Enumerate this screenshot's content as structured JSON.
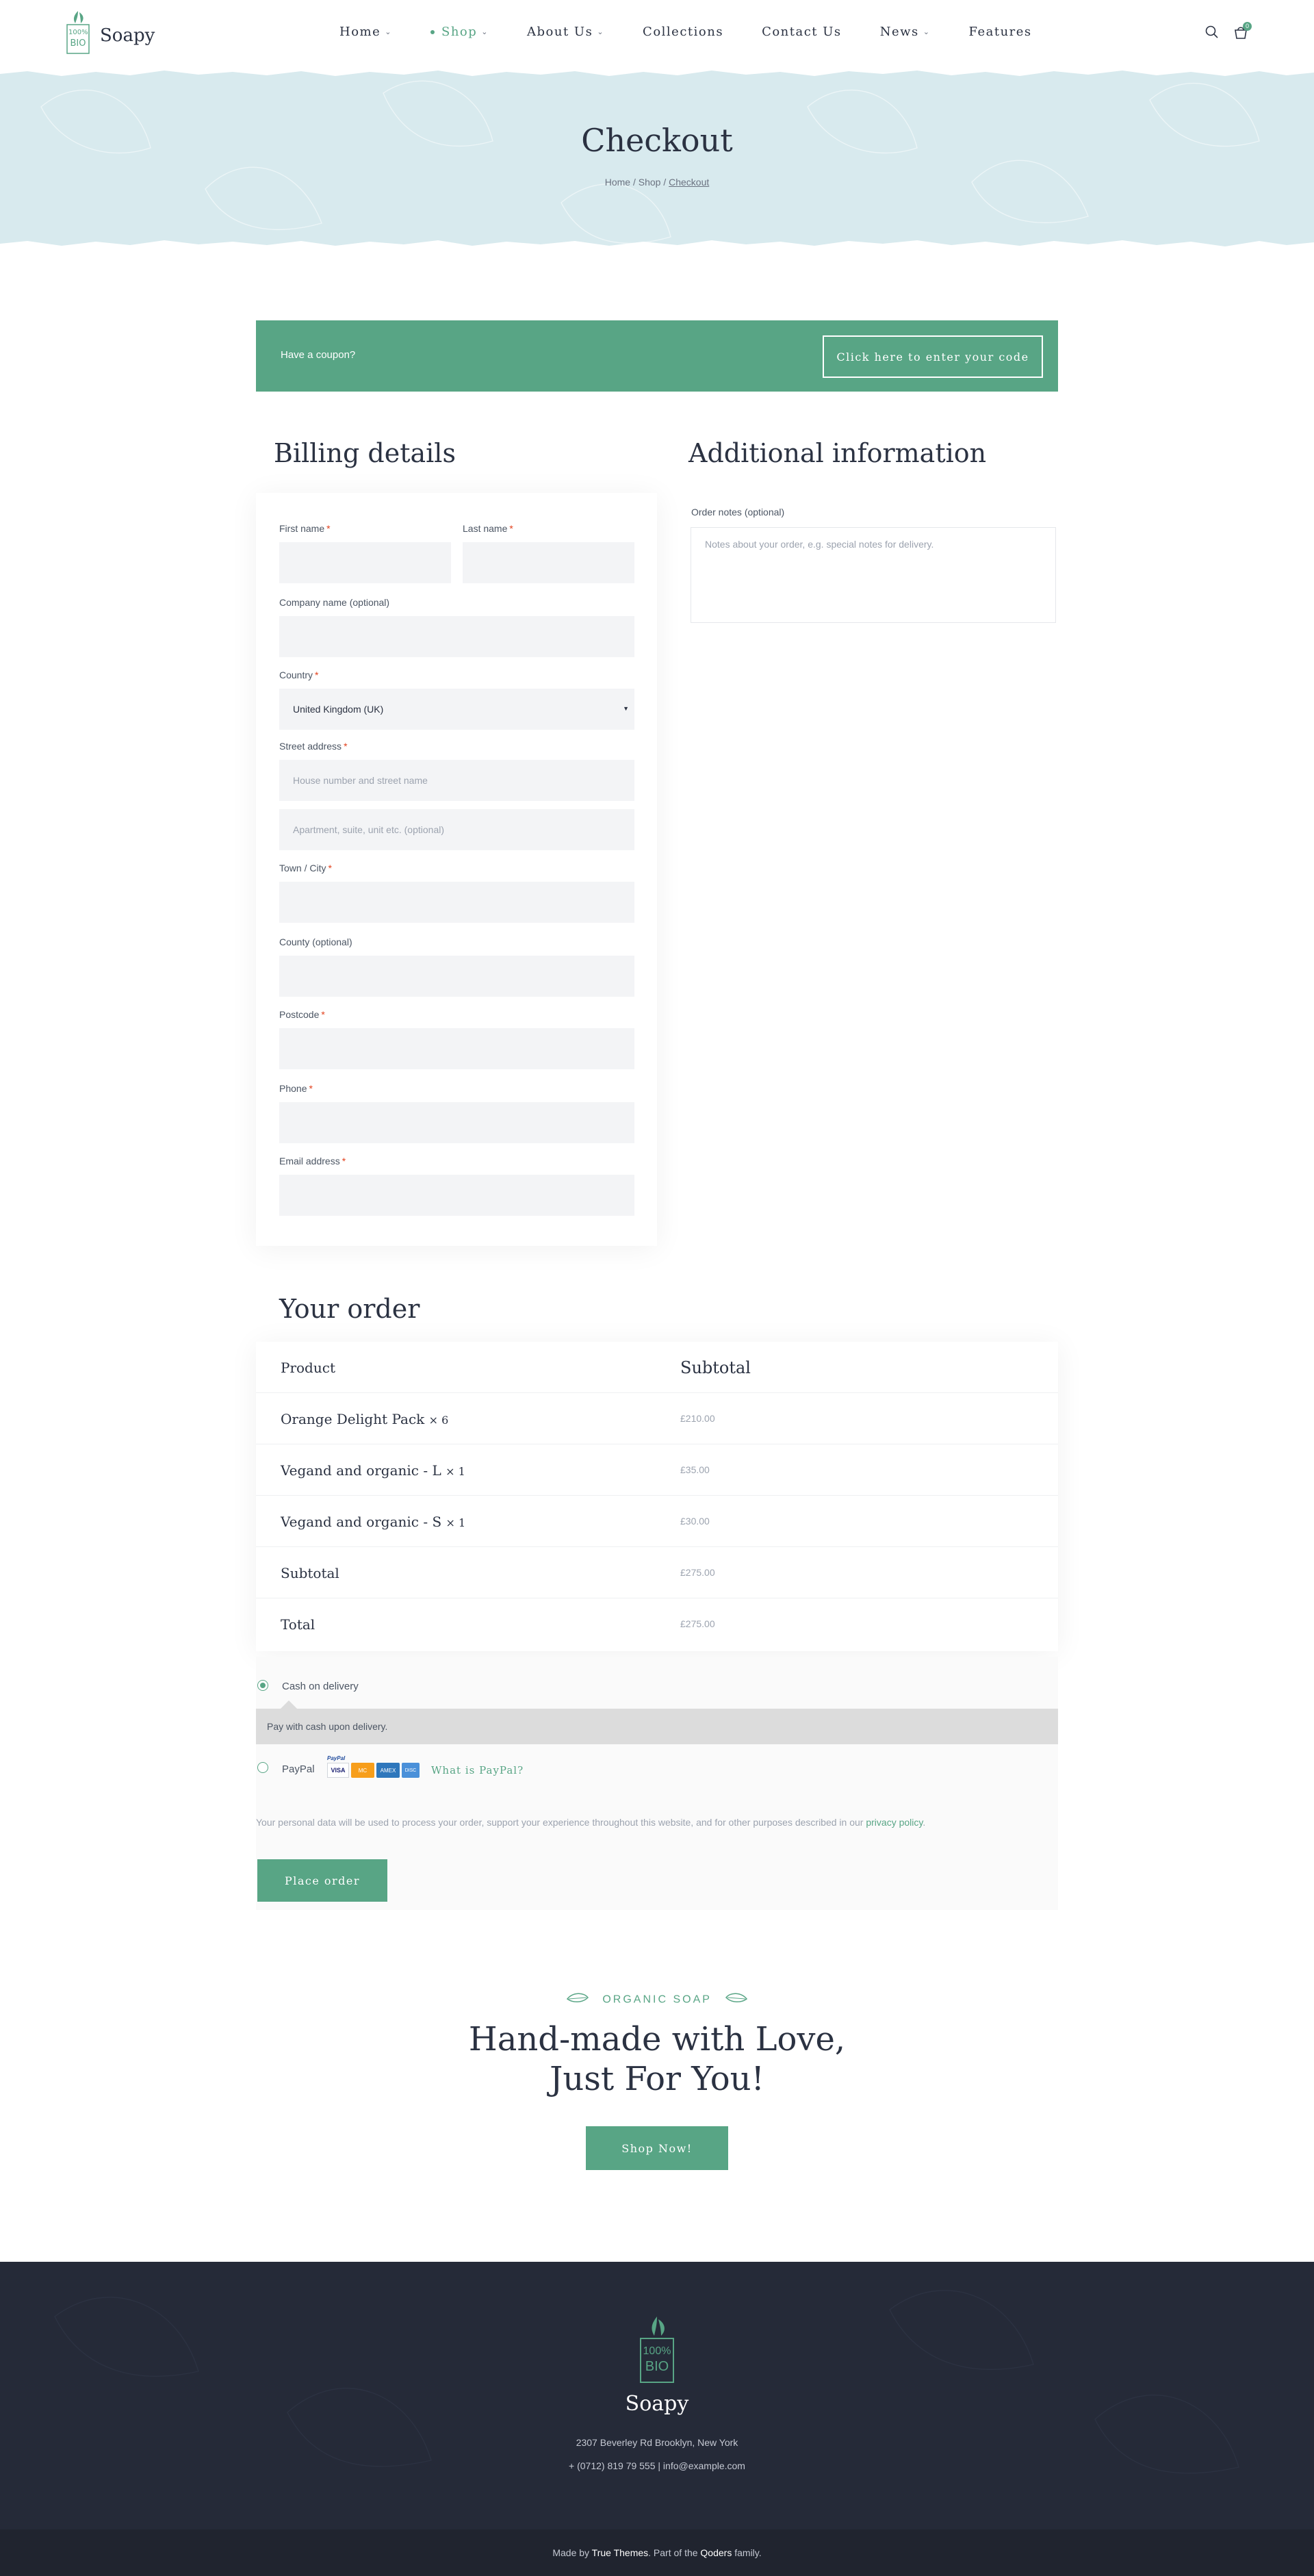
{
  "brand": {
    "name": "Soapy",
    "badge_top": "100%",
    "badge_bottom": "BIO"
  },
  "nav": {
    "items": [
      {
        "label": "Home",
        "has_dropdown": true,
        "active": false
      },
      {
        "label": "Shop",
        "has_dropdown": true,
        "active": true
      },
      {
        "label": "About Us",
        "has_dropdown": true,
        "active": false
      },
      {
        "label": "Collections",
        "has_dropdown": false,
        "active": false
      },
      {
        "label": "Contact Us",
        "has_dropdown": false,
        "active": false
      },
      {
        "label": "News",
        "has_dropdown": true,
        "active": false
      },
      {
        "label": "Features",
        "has_dropdown": false,
        "active": false
      }
    ],
    "cart_count": "0"
  },
  "hero": {
    "title": "Checkout",
    "breadcrumb": {
      "home": "Home",
      "shop": "Shop",
      "current": "Checkout",
      "sep": "/"
    }
  },
  "coupon": {
    "text": "Have a coupon?",
    "button": "Click here to enter your code"
  },
  "billing": {
    "title": "Billing details",
    "fields": {
      "first_name": "First name",
      "last_name": "Last name",
      "company": "Company name (optional)",
      "country": "Country",
      "country_value": "United Kingdom (UK)",
      "street": "Street address",
      "street_ph1": "House number and street name",
      "street_ph2": "Apartment, suite, unit etc. (optional)",
      "town": "Town / City",
      "county": "County (optional)",
      "postcode": "Postcode",
      "phone": "Phone",
      "email": "Email address"
    },
    "required_mark": "*"
  },
  "additional": {
    "title": "Additional information",
    "notes_label": "Order notes (optional)",
    "notes_placeholder": "Notes about your order, e.g. special notes for delivery."
  },
  "order": {
    "title": "Your order",
    "head_product": "Product",
    "head_subtotal": "Subtotal",
    "items": [
      {
        "name": "Orange Delight Pack",
        "qty": "× 6",
        "price": "£210.00"
      },
      {
        "name": "Vegand and organic - L",
        "qty": "× 1",
        "price": "£35.00"
      },
      {
        "name": "Vegand and organic - S",
        "qty": "× 1",
        "price": "£30.00"
      }
    ],
    "subtotal_label": "Subtotal",
    "subtotal": "£275.00",
    "total_label": "Total",
    "total": "£275.00"
  },
  "payment": {
    "cod_label": "Cash on delivery",
    "cod_desc": "Pay with cash upon delivery.",
    "paypal_label": "PayPal",
    "paypal_link": "What is PayPal?",
    "card_logos": [
      "VISA",
      "MC",
      "AMEX",
      "DISC"
    ],
    "paypal_mini": "PayPal",
    "privacy_text": "Your personal data will be used to process your order, support your experience throughout this website, and for other purposes described in our",
    "privacy_link": "privacy policy",
    "privacy_end": ".",
    "place_order": "Place order"
  },
  "promo": {
    "kicker": "ORGANIC SOAP",
    "title_line1": "Hand-made with Love,",
    "title_line2": "Just For You!",
    "button": "Shop Now!"
  },
  "footer": {
    "name": "Soapy",
    "address": "2307 Beverley Rd Brooklyn, New York",
    "contact": "+ (0712) 819 79 555 | info@example.com",
    "made_by": "Made by",
    "made_by_name": "True Themes",
    "part_of": ". Part of the",
    "family_name": "Qoders",
    "family": "family."
  },
  "colors": {
    "accent": "#58a585",
    "hero_bg": "#d8eaee",
    "footer_bg": "#252a38",
    "text": "#2b3242"
  }
}
